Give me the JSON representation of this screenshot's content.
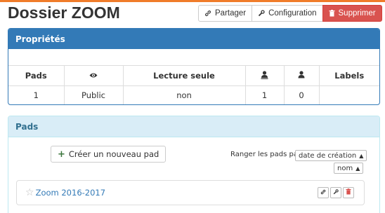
{
  "header": {
    "title": "Dossier ZOOM",
    "buttons": {
      "share": "Partager",
      "config": "Configuration",
      "delete": "Supprimer"
    }
  },
  "properties": {
    "heading": "Propriétés",
    "columns": [
      "Pads",
      "visibility-icon",
      "Lecture seule",
      "admin-user-icon",
      "user-icon",
      "Labels"
    ],
    "column_labels": {
      "pads": "Pads",
      "readonly": "Lecture seule",
      "labels": "Labels"
    },
    "row": {
      "pads": "1",
      "visibility": "Public",
      "readonly": "non",
      "admins": "1",
      "users": "0",
      "labels": ""
    }
  },
  "pads_panel": {
    "heading": "Pads",
    "create_button": "Créer un nouveau pad",
    "sort_label": "Ranger les pads par",
    "sort_options": [
      "date de création",
      "nom"
    ],
    "items": [
      {
        "name": "Zoom 2016-2017",
        "favorite": false
      }
    ]
  },
  "colors": {
    "accent_top": "#f07c2a",
    "primary": "#337ab7",
    "danger": "#d9534f",
    "info_bg": "#d9edf7",
    "info_text": "#31708f"
  },
  "icons": [
    "link-icon",
    "wrench-icon",
    "trash-icon",
    "eye-icon",
    "admin-user-icon",
    "user-icon",
    "plus-icon",
    "star-icon",
    "caret-up-icon"
  ]
}
